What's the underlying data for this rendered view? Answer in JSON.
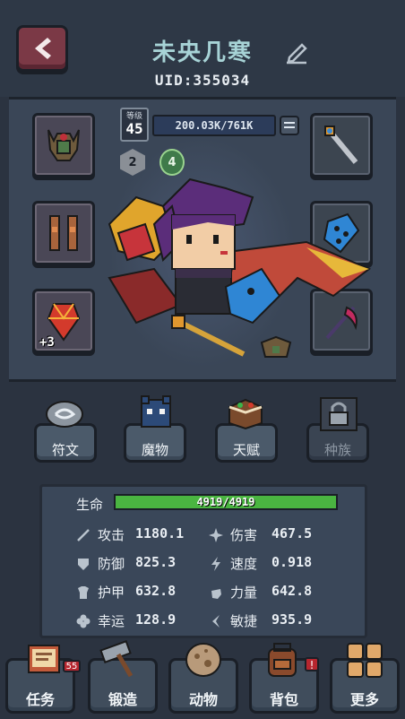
{
  "header": {
    "player_name": "未央几寒",
    "uid": "UID:355034"
  },
  "level": {
    "label": "等级",
    "value": "45",
    "exp": "200.03K/761K"
  },
  "badges": {
    "rank": "2",
    "stars": "4"
  },
  "equipment": {
    "left": [
      {
        "icon": "helmet-icon"
      },
      {
        "icon": "armor-icon"
      },
      {
        "icon": "gem-icon",
        "level": "+3"
      }
    ],
    "right": [
      {
        "icon": "sword-icon"
      },
      {
        "icon": "shield-icon"
      },
      {
        "icon": "scythe-icon"
      }
    ]
  },
  "categories": [
    {
      "label": "符文",
      "locked": false
    },
    {
      "label": "魔物",
      "locked": false
    },
    {
      "label": "天赋",
      "locked": false
    },
    {
      "label": "种族",
      "locked": true
    }
  ],
  "stats": {
    "hp": {
      "label": "生命",
      "value": "4919/4919",
      "fill": 1.0
    },
    "rows": [
      [
        {
          "label": "攻击",
          "value": "1180.1",
          "icon": "sword-icon"
        },
        {
          "label": "伤害",
          "value": "467.5",
          "icon": "burst-icon"
        }
      ],
      [
        {
          "label": "防御",
          "value": "825.3",
          "icon": "shield-icon"
        },
        {
          "label": "速度",
          "value": "0.918",
          "icon": "bolt-icon"
        }
      ],
      [
        {
          "label": "护甲",
          "value": "632.8",
          "icon": "armor-icon"
        },
        {
          "label": "力量",
          "value": "642.8",
          "icon": "fist-icon"
        }
      ],
      [
        {
          "label": "幸运",
          "value": "128.9",
          "icon": "clover-icon"
        },
        {
          "label": "敏捷",
          "value": "935.9",
          "icon": "wing-icon"
        }
      ]
    ]
  },
  "nav": [
    {
      "label": "任务",
      "badge": "55"
    },
    {
      "label": "锻造",
      "badge": ""
    },
    {
      "label": "动物",
      "badge": ""
    },
    {
      "label": "背包",
      "badge": "!"
    },
    {
      "label": "更多",
      "badge": ""
    }
  ],
  "colors": {
    "hp_green": "#4ab541",
    "back_button": "#7b3946",
    "name_color": "#a7d3d6"
  }
}
